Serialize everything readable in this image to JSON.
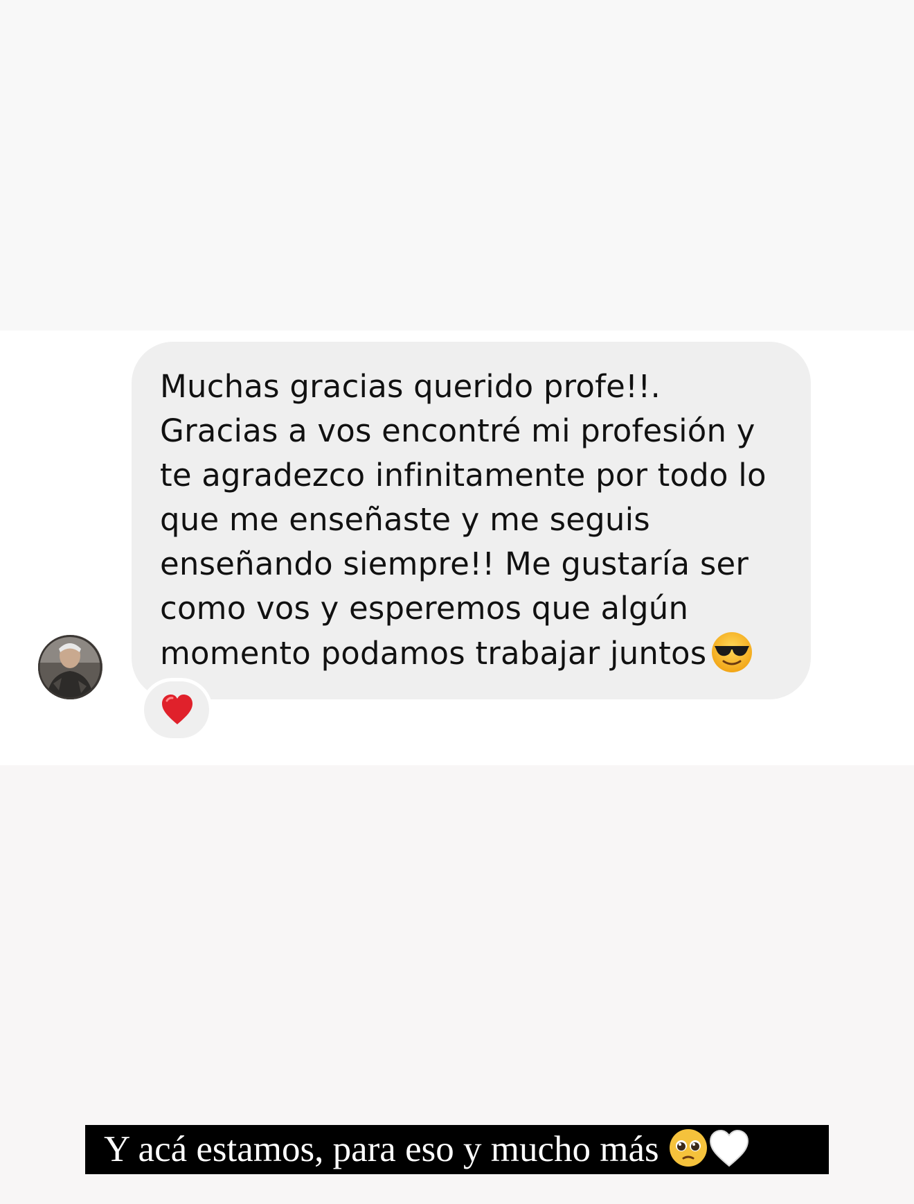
{
  "message": {
    "text": "Muchas gracias querido profe!!. Gracias a vos encontré mi profesión y te agradezco infinitamente por todo lo que me enseñaste y me seguis enseñando siempre!! Me gustaría ser como vos y esperemos que algún momento podamos trabajar juntos",
    "emoji_icon": "smiling-face-with-sunglasses-icon",
    "reaction_icon": "red-heart-icon",
    "reaction_color": "#e0212b"
  },
  "sender": {
    "avatar_icon": "profile-photo"
  },
  "caption": {
    "text": "Y acá estamos, para eso y mucho más",
    "emoji_icons": [
      "pleading-face-icon",
      "white-heart-icon"
    ]
  },
  "colors": {
    "bubble": "#efefef",
    "background": "#f8f8f8",
    "caption_bg": "#000000",
    "caption_text": "#ffffff"
  }
}
